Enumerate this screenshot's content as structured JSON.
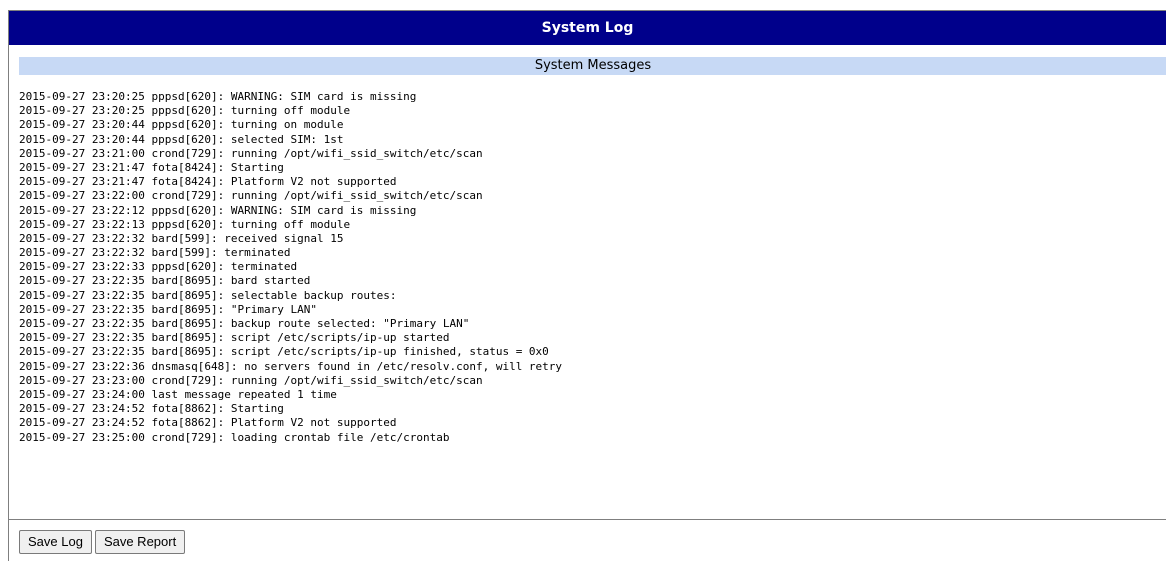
{
  "header": {
    "title": "System Log"
  },
  "section": {
    "title": "System Messages"
  },
  "log": {
    "lines": [
      "2015-09-27 23:20:25 pppsd[620]: WARNING: SIM card is missing",
      "2015-09-27 23:20:25 pppsd[620]: turning off module",
      "2015-09-27 23:20:44 pppsd[620]: turning on module",
      "2015-09-27 23:20:44 pppsd[620]: selected SIM: 1st",
      "2015-09-27 23:21:00 crond[729]: running /opt/wifi_ssid_switch/etc/scan",
      "2015-09-27 23:21:47 fota[8424]: Starting",
      "2015-09-27 23:21:47 fota[8424]: Platform V2 not supported",
      "2015-09-27 23:22:00 crond[729]: running /opt/wifi_ssid_switch/etc/scan",
      "2015-09-27 23:22:12 pppsd[620]: WARNING: SIM card is missing",
      "2015-09-27 23:22:13 pppsd[620]: turning off module",
      "2015-09-27 23:22:32 bard[599]: received signal 15",
      "2015-09-27 23:22:32 bard[599]: terminated",
      "2015-09-27 23:22:33 pppsd[620]: terminated",
      "2015-09-27 23:22:35 bard[8695]: bard started",
      "2015-09-27 23:22:35 bard[8695]: selectable backup routes:",
      "2015-09-27 23:22:35 bard[8695]: \"Primary LAN\"",
      "2015-09-27 23:22:35 bard[8695]: backup route selected: \"Primary LAN\"",
      "2015-09-27 23:22:35 bard[8695]: script /etc/scripts/ip-up started",
      "2015-09-27 23:22:35 bard[8695]: script /etc/scripts/ip-up finished, status = 0x0",
      "2015-09-27 23:22:36 dnsmasq[648]: no servers found in /etc/resolv.conf, will retry",
      "2015-09-27 23:23:00 crond[729]: running /opt/wifi_ssid_switch/etc/scan",
      "2015-09-27 23:24:00 last message repeated 1 time",
      "2015-09-27 23:24:52 fota[8862]: Starting",
      "2015-09-27 23:24:52 fota[8862]: Platform V2 not supported",
      "2015-09-27 23:25:00 crond[729]: loading crontab file /etc/crontab"
    ]
  },
  "actions": {
    "save_log_label": "Save Log",
    "save_report_label": "Save Report"
  },
  "colors": {
    "title_bar": "#00008b",
    "subheader": "#c7d9f5"
  }
}
